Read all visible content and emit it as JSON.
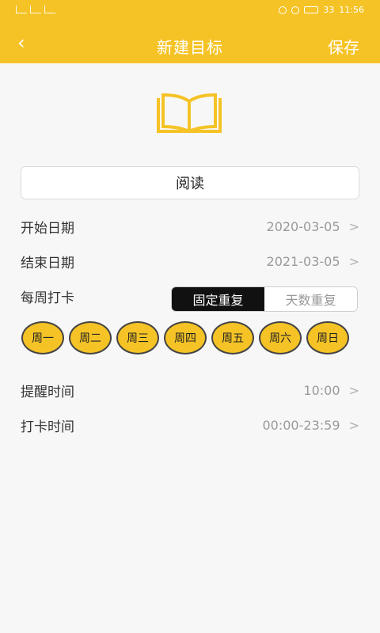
{
  "status_bar": {
    "left_icons": [
      "sim-icon",
      "signal-icon",
      "signal-icon"
    ],
    "right_icons": [
      "alarm-icon",
      "vibrate-icon",
      "battery-icon"
    ],
    "battery": "33",
    "time": "11:56"
  },
  "navbar": {
    "back_icon": "chevron-left-icon",
    "title": "新建目标",
    "save": "保存"
  },
  "goal": {
    "icon": "book-icon",
    "name": "阅读"
  },
  "rows": {
    "start": {
      "label": "开始日期",
      "value": "2020-03-05",
      "chevron": ">"
    },
    "end": {
      "label": "结束日期",
      "value": "2021-03-05",
      "chevron": ">"
    },
    "weekly": {
      "label": "每周打卡"
    },
    "reminder": {
      "label": "提醒时间",
      "value": "10:00",
      "chevron": ">"
    },
    "checkin": {
      "label": "打卡时间",
      "value": "00:00-23:59",
      "chevron": ">"
    }
  },
  "repeat_toggle": {
    "fixed": "固定重复",
    "days": "天数重复",
    "selected": "fixed"
  },
  "weekdays": [
    "周一",
    "周二",
    "周三",
    "周四",
    "周五",
    "周六",
    "周日"
  ],
  "colors": {
    "accent": "#f5c326",
    "background": "#f7f7f7",
    "toggle_active": "#111111"
  }
}
